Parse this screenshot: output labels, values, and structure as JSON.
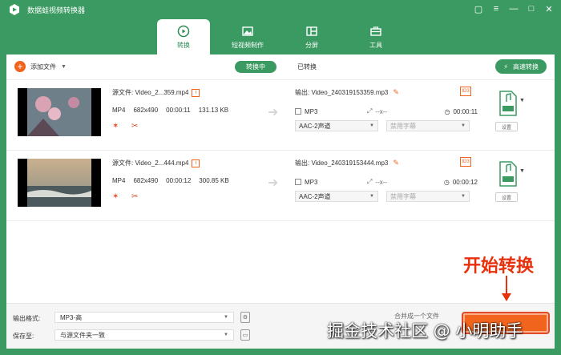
{
  "app": {
    "title": "数据蛙视频转换器"
  },
  "window_controls": [
    "restore-icon",
    "menu-icon",
    "minimize-icon",
    "maximize-icon",
    "close-icon"
  ],
  "tabs": [
    {
      "label": "转换",
      "icon": "convert-icon",
      "active": true
    },
    {
      "label": "短视频制作",
      "icon": "image-icon",
      "active": false
    },
    {
      "label": "分屏",
      "icon": "split-icon",
      "active": false
    },
    {
      "label": "工具",
      "icon": "toolbox-icon",
      "active": false
    }
  ],
  "toolbar": {
    "add_file_label": "添加文件",
    "converting_label": "转换中",
    "converted_label": "已转换",
    "speed_label": "高速转换"
  },
  "files": [
    {
      "source_label": "源文件: Video_2...359.mp4",
      "format": "MP4",
      "resolution": "682x490",
      "duration": "00:00:11",
      "size": "131.13 KB",
      "output_label": "输出: Video_240319153359.mp3",
      "output_format": "MP3",
      "output_res": "--x--",
      "output_duration": "00:00:11",
      "audio_track": "AAC-2声道",
      "subtitle": "禁用字幕",
      "settings_label": "设置"
    },
    {
      "source_label": "源文件: Video_2...444.mp4",
      "format": "MP4",
      "resolution": "682x490",
      "duration": "00:00:12",
      "size": "300.85 KB",
      "output_label": "输出: Video_240319153444.mp3",
      "output_format": "MP3",
      "output_res": "--x--",
      "output_duration": "00:00:12",
      "audio_track": "AAC-2声道",
      "subtitle": "禁用字幕",
      "settings_label": "设置"
    }
  ],
  "bottom": {
    "output_format_label": "输出格式:",
    "output_format_value": "MP3-高",
    "save_to_label": "保存至:",
    "save_to_value": "与源文件夹一致",
    "merge_label": "合并成一个文件"
  },
  "annotation": {
    "start_label": "开始转换",
    "watermark": "掘金技术社区 @ 小明助手"
  },
  "colors": {
    "brand": "#3b9a62",
    "accent": "#f0641e",
    "annotation": "#e8300c"
  }
}
